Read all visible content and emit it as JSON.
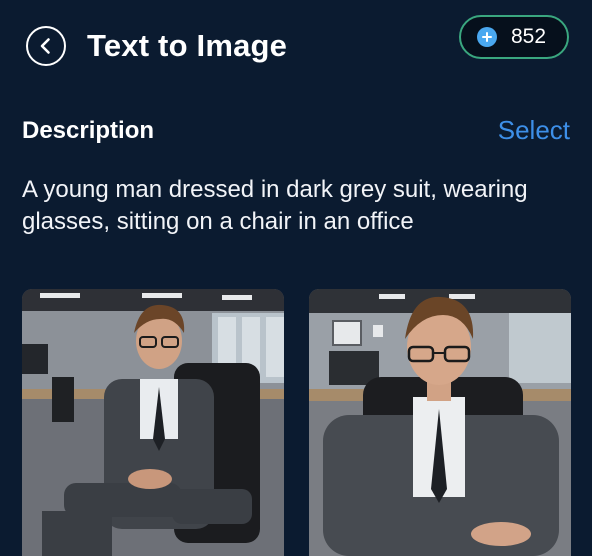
{
  "header": {
    "title": "Text to Image",
    "back_icon": "chevron-left-icon",
    "credits": "852",
    "credit_icon": "plus-circle-icon"
  },
  "description": {
    "label": "Description",
    "select_label": "Select",
    "text": "A young man dressed in dark grey suit, wearing glasses, sitting on a chair in an office"
  },
  "results": [
    {
      "icon": "generated-image-1"
    },
    {
      "icon": "generated-image-2"
    }
  ],
  "colors": {
    "background": "#0b1b30",
    "accent": "#3d8fe8",
    "credit_border": "#3aa77f"
  }
}
